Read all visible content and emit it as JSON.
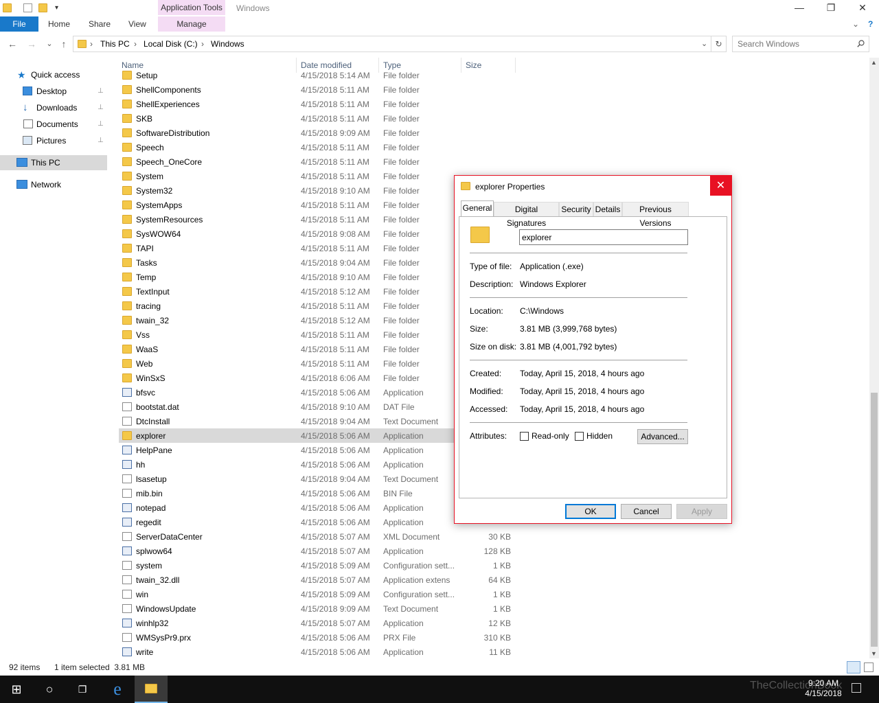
{
  "window": {
    "title": "Windows",
    "context_tab": "Application Tools",
    "minimize": "—",
    "restore": "❐",
    "close": "✕"
  },
  "ribbon": {
    "file": "File",
    "tabs": [
      "Home",
      "Share",
      "View"
    ],
    "manage": "Manage",
    "expand": "⌄",
    "help": "?"
  },
  "nav": {
    "back": "←",
    "forward": "→",
    "recent": "⌄",
    "up": "↑",
    "refresh": "↻"
  },
  "address": {
    "crumbs": [
      "This PC",
      "Local Disk (C:)",
      "Windows"
    ],
    "separator": "›"
  },
  "search": {
    "placeholder": "Search Windows"
  },
  "navpane": {
    "quick_access": "Quick access",
    "items": [
      {
        "label": "Desktop",
        "pinned": true
      },
      {
        "label": "Downloads",
        "pinned": true
      },
      {
        "label": "Documents",
        "pinned": true
      },
      {
        "label": "Pictures",
        "pinned": true
      }
    ],
    "this_pc": "This PC",
    "network": "Network",
    "pin_glyph": "📌"
  },
  "columns": {
    "name": "Name",
    "date": "Date modified",
    "type": "Type",
    "size": "Size"
  },
  "files": [
    {
      "name": "Setup",
      "date": "4/15/2018 5:14 AM",
      "type": "File folder",
      "size": "",
      "icon": "folder"
    },
    {
      "name": "ShellComponents",
      "date": "4/15/2018 5:11 AM",
      "type": "File folder",
      "size": "",
      "icon": "folder"
    },
    {
      "name": "ShellExperiences",
      "date": "4/15/2018 5:11 AM",
      "type": "File folder",
      "size": "",
      "icon": "folder"
    },
    {
      "name": "SKB",
      "date": "4/15/2018 5:11 AM",
      "type": "File folder",
      "size": "",
      "icon": "folder"
    },
    {
      "name": "SoftwareDistribution",
      "date": "4/15/2018 9:09 AM",
      "type": "File folder",
      "size": "",
      "icon": "folder"
    },
    {
      "name": "Speech",
      "date": "4/15/2018 5:11 AM",
      "type": "File folder",
      "size": "",
      "icon": "folder"
    },
    {
      "name": "Speech_OneCore",
      "date": "4/15/2018 5:11 AM",
      "type": "File folder",
      "size": "",
      "icon": "folder"
    },
    {
      "name": "System",
      "date": "4/15/2018 5:11 AM",
      "type": "File folder",
      "size": "",
      "icon": "folder"
    },
    {
      "name": "System32",
      "date": "4/15/2018 9:10 AM",
      "type": "File folder",
      "size": "",
      "icon": "folder"
    },
    {
      "name": "SystemApps",
      "date": "4/15/2018 5:11 AM",
      "type": "File folder",
      "size": "",
      "icon": "folder"
    },
    {
      "name": "SystemResources",
      "date": "4/15/2018 5:11 AM",
      "type": "File folder",
      "size": "",
      "icon": "folder"
    },
    {
      "name": "SysWOW64",
      "date": "4/15/2018 9:08 AM",
      "type": "File folder",
      "size": "",
      "icon": "folder"
    },
    {
      "name": "TAPI",
      "date": "4/15/2018 5:11 AM",
      "type": "File folder",
      "size": "",
      "icon": "folder"
    },
    {
      "name": "Tasks",
      "date": "4/15/2018 9:04 AM",
      "type": "File folder",
      "size": "",
      "icon": "folder"
    },
    {
      "name": "Temp",
      "date": "4/15/2018 9:10 AM",
      "type": "File folder",
      "size": "",
      "icon": "folder"
    },
    {
      "name": "TextInput",
      "date": "4/15/2018 5:12 AM",
      "type": "File folder",
      "size": "",
      "icon": "folder"
    },
    {
      "name": "tracing",
      "date": "4/15/2018 5:11 AM",
      "type": "File folder",
      "size": "",
      "icon": "folder"
    },
    {
      "name": "twain_32",
      "date": "4/15/2018 5:12 AM",
      "type": "File folder",
      "size": "",
      "icon": "folder"
    },
    {
      "name": "Vss",
      "date": "4/15/2018 5:11 AM",
      "type": "File folder",
      "size": "",
      "icon": "folder"
    },
    {
      "name": "WaaS",
      "date": "4/15/2018 5:11 AM",
      "type": "File folder",
      "size": "",
      "icon": "folder"
    },
    {
      "name": "Web",
      "date": "4/15/2018 5:11 AM",
      "type": "File folder",
      "size": "",
      "icon": "folder"
    },
    {
      "name": "WinSxS",
      "date": "4/15/2018 6:06 AM",
      "type": "File folder",
      "size": "",
      "icon": "folder"
    },
    {
      "name": "bfsvc",
      "date": "4/15/2018 5:06 AM",
      "type": "Application",
      "size": "",
      "icon": "app"
    },
    {
      "name": "bootstat.dat",
      "date": "4/15/2018 9:10 AM",
      "type": "DAT File",
      "size": "",
      "icon": "doc"
    },
    {
      "name": "DtcInstall",
      "date": "4/15/2018 9:04 AM",
      "type": "Text Document",
      "size": "",
      "icon": "doc"
    },
    {
      "name": "explorer",
      "date": "4/15/2018 5:06 AM",
      "type": "Application",
      "size": "",
      "icon": "folder",
      "selected": true
    },
    {
      "name": "HelpPane",
      "date": "4/15/2018 5:06 AM",
      "type": "Application",
      "size": "",
      "icon": "app"
    },
    {
      "name": "hh",
      "date": "4/15/2018 5:06 AM",
      "type": "Application",
      "size": "",
      "icon": "app"
    },
    {
      "name": "lsasetup",
      "date": "4/15/2018 9:04 AM",
      "type": "Text Document",
      "size": "",
      "icon": "doc"
    },
    {
      "name": "mib.bin",
      "date": "4/15/2018 5:06 AM",
      "type": "BIN File",
      "size": "",
      "icon": "doc"
    },
    {
      "name": "notepad",
      "date": "4/15/2018 5:06 AM",
      "type": "Application",
      "size": "",
      "icon": "app"
    },
    {
      "name": "regedit",
      "date": "4/15/2018 5:06 AM",
      "type": "Application",
      "size": "",
      "icon": "app"
    },
    {
      "name": "ServerDataCenter",
      "date": "4/15/2018 5:07 AM",
      "type": "XML Document",
      "size": "30 KB",
      "icon": "doc"
    },
    {
      "name": "splwow64",
      "date": "4/15/2018 5:07 AM",
      "type": "Application",
      "size": "128 KB",
      "icon": "app"
    },
    {
      "name": "system",
      "date": "4/15/2018 5:09 AM",
      "type": "Configuration sett...",
      "size": "1 KB",
      "icon": "doc"
    },
    {
      "name": "twain_32.dll",
      "date": "4/15/2018 5:07 AM",
      "type": "Application extens",
      "size": "64 KB",
      "icon": "doc"
    },
    {
      "name": "win",
      "date": "4/15/2018 5:09 AM",
      "type": "Configuration sett...",
      "size": "1 KB",
      "icon": "doc"
    },
    {
      "name": "WindowsUpdate",
      "date": "4/15/2018 9:09 AM",
      "type": "Text Document",
      "size": "1 KB",
      "icon": "doc"
    },
    {
      "name": "winhlp32",
      "date": "4/15/2018 5:07 AM",
      "type": "Application",
      "size": "12 KB",
      "icon": "app"
    },
    {
      "name": "WMSysPr9.prx",
      "date": "4/15/2018 5:06 AM",
      "type": "PRX File",
      "size": "310 KB",
      "icon": "doc"
    },
    {
      "name": "write",
      "date": "4/15/2018 5:06 AM",
      "type": "Application",
      "size": "11 KB",
      "icon": "app"
    }
  ],
  "status": {
    "count": "92 items",
    "selection": "1 item selected  3.81 MB"
  },
  "taskbar": {
    "start": "⊞",
    "search": "○",
    "taskview": "❐",
    "ie": "e",
    "time": "9:20 AM",
    "date": "4/15/2018",
    "watermark": "TheCollectionBook"
  },
  "dialog": {
    "title": "explorer Properties",
    "close": "✕",
    "tabs": [
      "General",
      "Digital Signatures",
      "Security",
      "Details",
      "Previous Versions"
    ],
    "file_name": "explorer",
    "type_label": "Type of file:",
    "type_value": "Application (.exe)",
    "desc_label": "Description:",
    "desc_value": "Windows Explorer",
    "location_label": "Location:",
    "location_value": "C:\\Windows",
    "size_label": "Size:",
    "size_value": "3.81 MB (3,999,768 bytes)",
    "disk_label": "Size on disk:",
    "disk_value": "3.81 MB (4,001,792 bytes)",
    "created_label": "Created:",
    "created_value": "Today, April 15, 2018, 4 hours ago",
    "modified_label": "Modified:",
    "modified_value": "Today, April 15, 2018, 4 hours ago",
    "accessed_label": "Accessed:",
    "accessed_value": "Today, April 15, 2018, 4 hours ago",
    "attributes_label": "Attributes:",
    "readonly_label": "Read-only",
    "hidden_label": "Hidden",
    "advanced": "Advanced...",
    "ok": "OK",
    "cancel": "Cancel",
    "apply": "Apply"
  }
}
